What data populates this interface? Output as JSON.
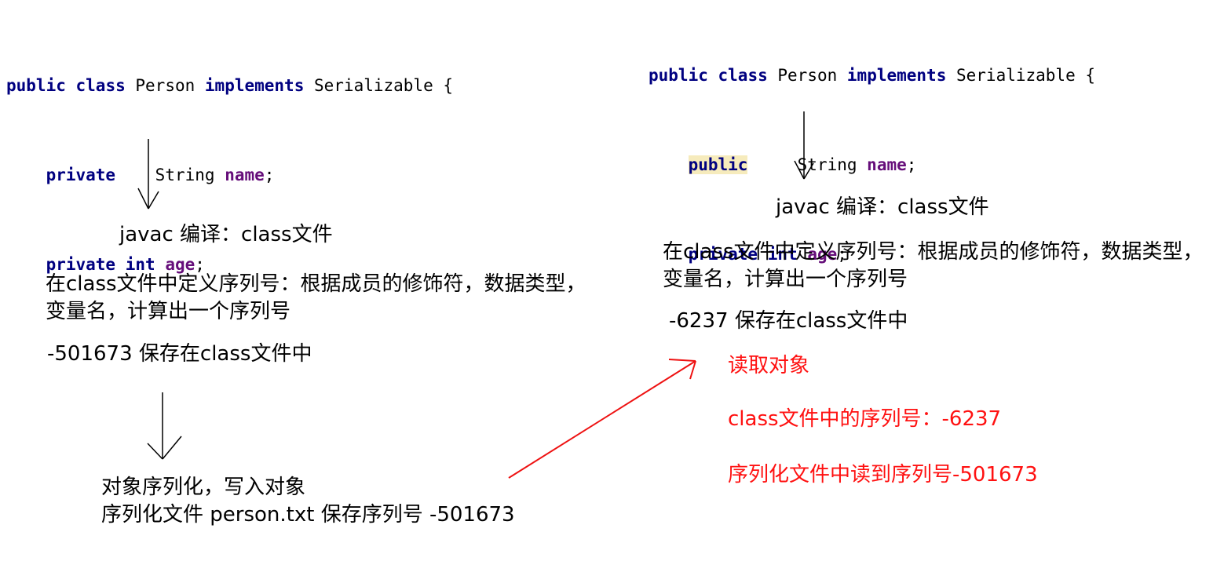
{
  "left": {
    "code": {
      "l1": {
        "public": "public",
        "class": "class",
        "name": "Person",
        "implements": "implements",
        "iface": "Serializable",
        "brace": "{"
      },
      "l2": {
        "mod": "private",
        "type": "String",
        "field": "name",
        "semi": ";"
      },
      "l3": {
        "mod": "private",
        "type": "int",
        "field": "age",
        "semi": ";"
      }
    },
    "compile": "javac 编译：class文件",
    "define_line1": "在class文件中定义序列号：根据成员的修饰符，数据类型，",
    "define_line2": "变量名，计算出一个序列号",
    "serial": "-501673 保存在class文件中",
    "serialize_line1": "对象序列化，写入对象",
    "serialize_line2": "序列化文件 person.txt 保存序列号 -501673"
  },
  "right": {
    "code": {
      "l1": {
        "public": "public",
        "class": "class",
        "name": "Person",
        "implements": "implements",
        "iface": "Serializable",
        "brace": "{"
      },
      "l2": {
        "mod": "public",
        "type": "String",
        "field": "name",
        "semi": ";"
      },
      "l3": {
        "mod": "private",
        "type": "int",
        "field": "age",
        "semi": ";"
      }
    },
    "compile": "javac 编译：class文件",
    "define_line1": "在class文件中定义序列号：根据成员的修饰符，数据类型，",
    "define_line2": "变量名，计算出一个序列号",
    "serial": "-6237  保存在class文件中",
    "read": "读取对象",
    "class_serial": "class文件中的序列号：-6237",
    "file_serial": "序列化文件中读到序列号-501673"
  },
  "colors": {
    "keyword": "#000080",
    "field": "#660e7a",
    "highlight": "#f6ebbc",
    "annotation": "#ff1111",
    "text": "#000000"
  }
}
